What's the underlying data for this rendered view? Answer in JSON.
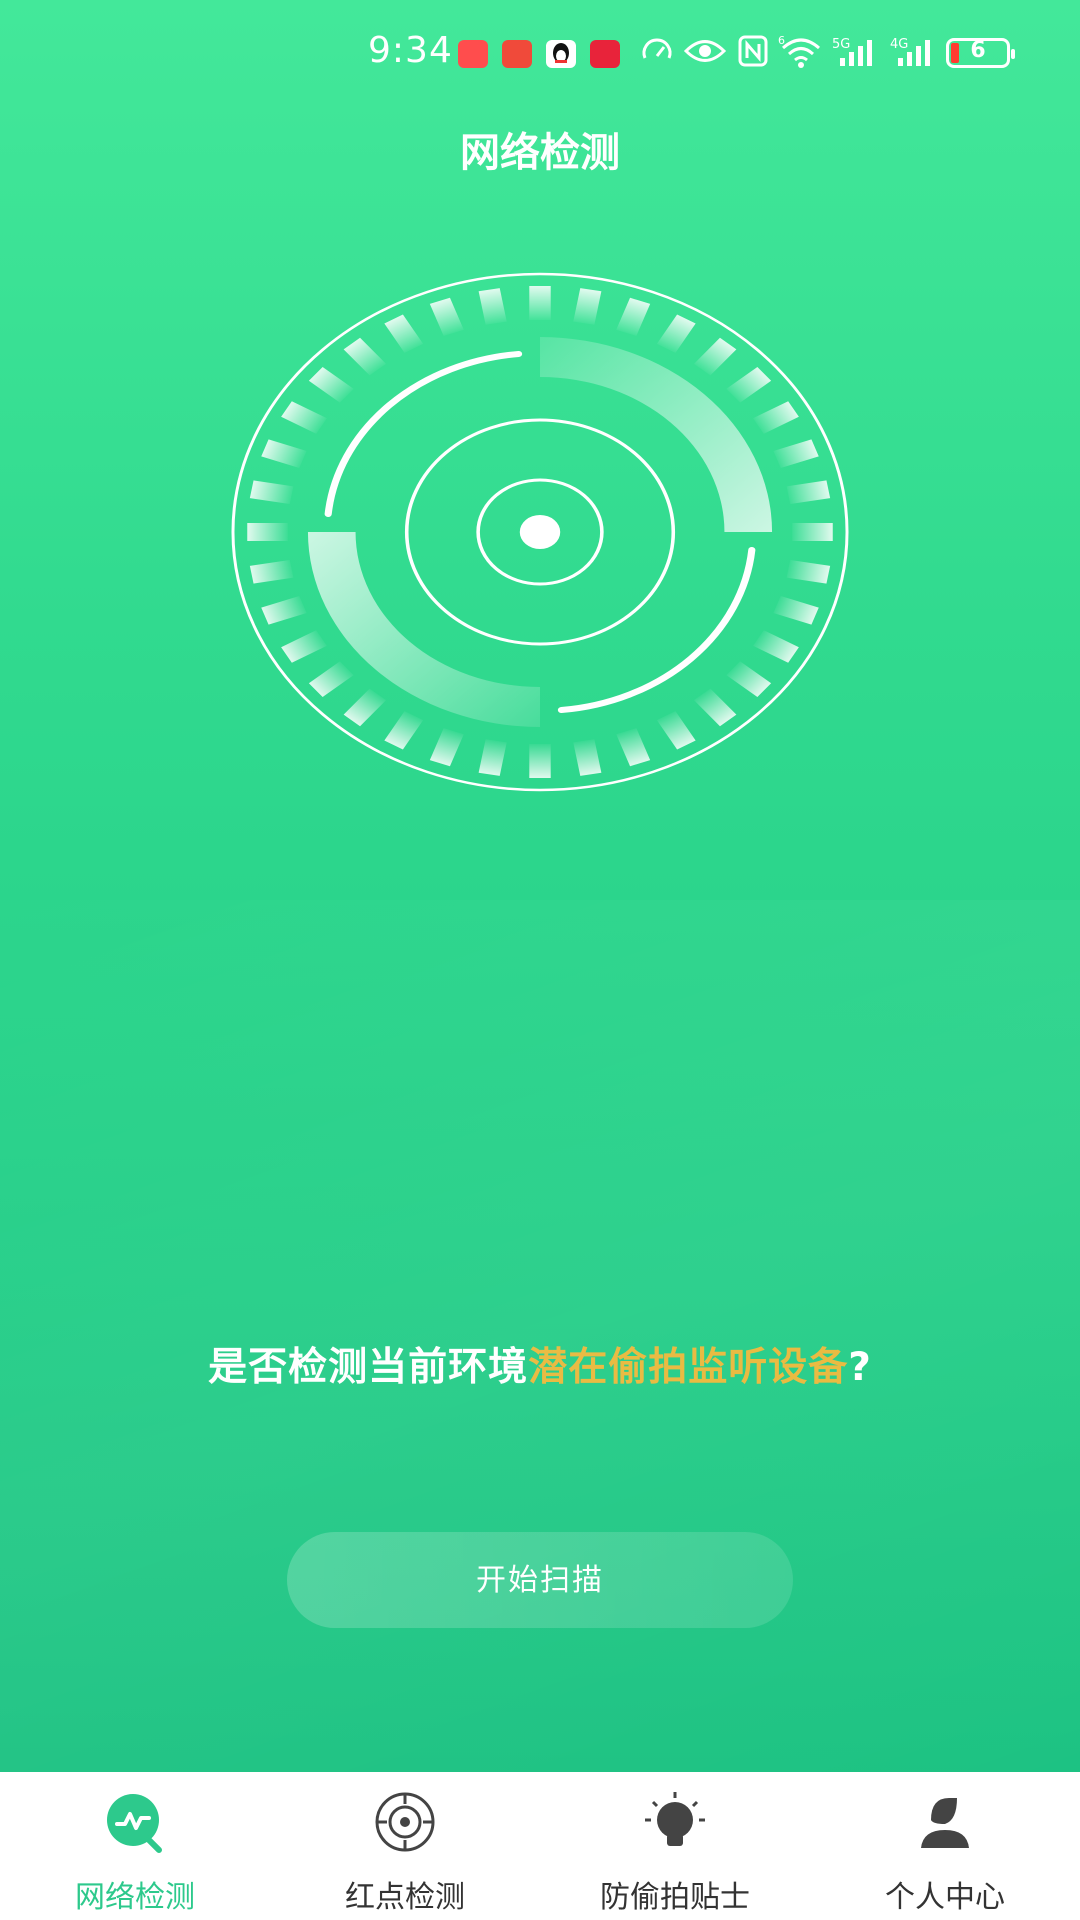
{
  "status_bar": {
    "time": "9:34",
    "battery_level": "6",
    "network_labels": [
      "5G",
      "4G"
    ],
    "wifi_sup": "6"
  },
  "page": {
    "title": "网络检测"
  },
  "prompt": {
    "prefix": "是否检测当前环境",
    "highlight": "潜在偷拍监听设备",
    "suffix": "?"
  },
  "scan_button": {
    "label": "开始扫描"
  },
  "bottom_nav": {
    "items": [
      {
        "label": "网络检测",
        "icon": "network-check-icon",
        "active": true
      },
      {
        "label": "红点检测",
        "icon": "crosshair-icon",
        "active": false
      },
      {
        "label": "防偷拍贴士",
        "icon": "lightbulb-icon",
        "active": false
      },
      {
        "label": "个人中心",
        "icon": "user-icon",
        "active": false
      }
    ]
  },
  "colors": {
    "bg_top": "#43e89a",
    "bg_bottom": "#1cc282",
    "highlight": "#e8b83a",
    "nav_active": "#2dc98c",
    "nav_inactive": "#333333"
  }
}
